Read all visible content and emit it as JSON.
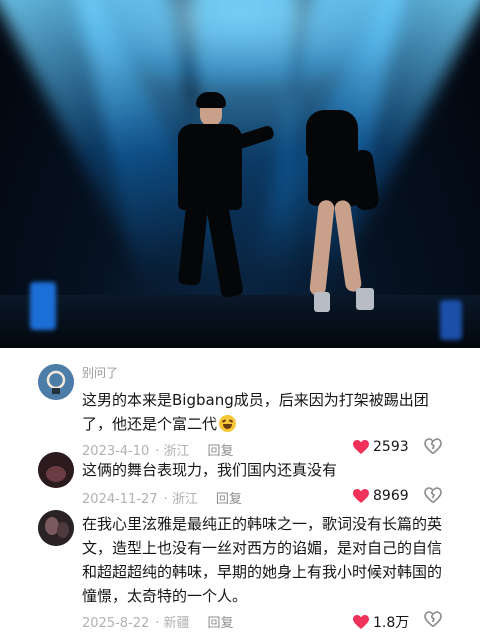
{
  "comments": [
    {
      "username": "别问了",
      "text": "这男的本来是Bigbang成员，后来因为打架被踢出团了，他还是个富二代",
      "emoji": "laughing-crying-emoji",
      "date": "2023-4-10",
      "location": "· 浙江",
      "reply_label": "回复",
      "likes": "2593"
    },
    {
      "username": "",
      "text": "这俩的舞台表现力，我们国内还真没有",
      "date": "2024-11-27",
      "location": "· 浙江",
      "reply_label": "回复",
      "likes": "8969"
    },
    {
      "username": "",
      "text": "在我心里泫雅是最纯正的韩味之一，歌词没有长篇的英文，造型上也没有一丝对西方的谄媚，是对自己的自信和超超超纯的韩味，早期的她身上有我小时候对韩国的憧憬，太奇特的一个人。",
      "date": "2025-8-22",
      "location": "· 新疆",
      "reply_label": "回复",
      "likes": "1.8万"
    }
  ],
  "colors": {
    "like_heart": "#f0325a",
    "meta_text": "#b1b1b1",
    "body_text": "#161616",
    "stage_blue": "#2aa8f0"
  },
  "icons": [
    "heart-icon",
    "broken-heart-icon"
  ]
}
